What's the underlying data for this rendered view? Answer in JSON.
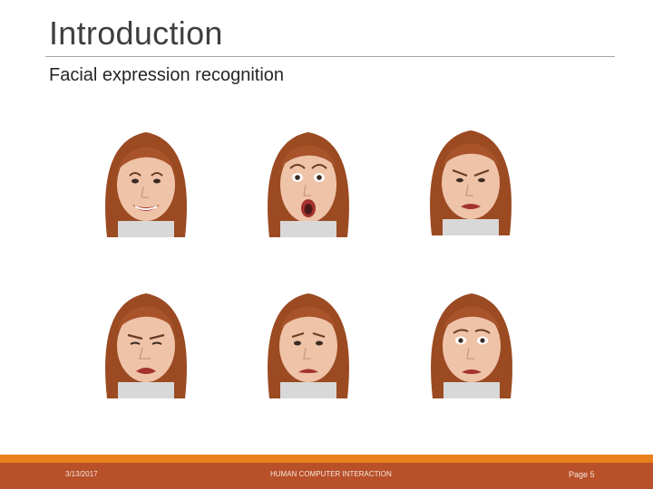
{
  "slide": {
    "title": "Introduction",
    "bullet": "Facial expression recognition"
  },
  "faces": [
    {
      "expression": "happy"
    },
    {
      "expression": "surprise"
    },
    {
      "expression": "anger"
    },
    {
      "expression": "disgust"
    },
    {
      "expression": "sadness"
    },
    {
      "expression": "fear"
    }
  ],
  "footer": {
    "date": "3/13/2017",
    "center": "HUMAN COMPUTER INTERACTION",
    "page": "Page 5"
  },
  "colors": {
    "accent_stripe": "#e8811b",
    "footer_bar": "#b8502a",
    "hair": "#9b4a22",
    "skin": "#efc3a8"
  }
}
